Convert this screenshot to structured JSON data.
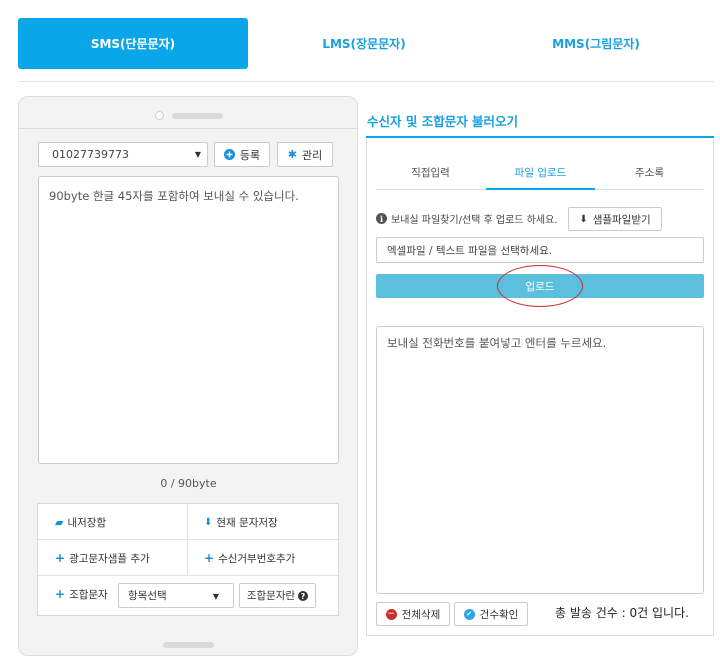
{
  "tabs": {
    "sms": "SMS(단문문자)",
    "lms": "LMS(장문문자)",
    "mms": "MMS(그림문자)"
  },
  "phone": {
    "sender_number": "01027739773",
    "register_label": "등록",
    "manage_label": "관리",
    "message_placeholder": "90byte 한글 45자를 포함하여 보내실 수 있습니다.",
    "byte_counter": "0 / 90byte",
    "my_storage": "내저장함",
    "save_current": "현재 문자저장",
    "add_ad_sample": "광고문자샘플 추가",
    "add_refusal_number": "수신거부번호추가",
    "combo_message": "조합문자",
    "item_select": "항목선택",
    "combo_field": "조합문자란"
  },
  "right": {
    "title": "수신자 및 조합문자 불러오기",
    "subtabs": [
      "직접입력",
      "파일 업로드",
      "주소록"
    ],
    "active_subtab": "파일 업로드",
    "info_text": "보내실 파일찾기/선택 후 업로드 하세요.",
    "sample_download": "샘플파일받기",
    "file_placeholder": "엑셀파일 / 텍스트 파일을 선택하세요.",
    "upload_label": "업로드",
    "numbers_placeholder": "보내실 전화번호를 붙여넣고 엔터를 누르세요.",
    "delete_all": "전체삭제",
    "check_count": "건수확인",
    "total_text": "총 발송 건수 : 0건 입니다."
  },
  "colors": {
    "accent": "#0aa6ea",
    "upload_bar": "#5bc0de",
    "highlight_circle": "#c9302c"
  }
}
